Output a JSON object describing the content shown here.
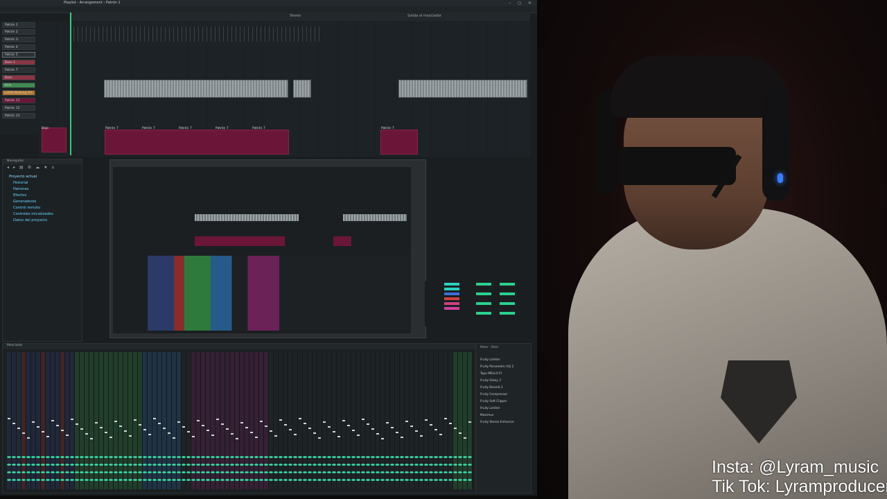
{
  "window": {
    "title": "Playlist - Arrangement › Patrón 1",
    "controls": "– ◻ ✕"
  },
  "playlist": {
    "markers": [
      "Stereo",
      "Salida al mezclador"
    ],
    "tracks": [
      "Patrón 1",
      "Patrón 2",
      "Patrón 3",
      "Patrón 4",
      "Patrón 5",
      "Bass 1",
      "Patrón 7",
      "Bass",
      "Kick",
      "LOAD Nothing #1",
      "Patrón 11",
      "Patrón 12",
      "Patrón 13"
    ],
    "clip_labels": [
      "Bajo",
      "Patrón 7",
      "Patrón 7",
      "Patrón 7",
      "Patrón 7",
      "Patrón 7",
      "Patrón 7"
    ]
  },
  "browser": {
    "title": "Navegador",
    "items": [
      {
        "label": "Proyecto actual",
        "level": 0
      },
      {
        "label": "Historial",
        "level": 1
      },
      {
        "label": "Patrones",
        "level": 1
      },
      {
        "label": "Efectos",
        "level": 1
      },
      {
        "label": "Generadores",
        "level": 1
      },
      {
        "label": "Control remoto",
        "level": 1
      },
      {
        "label": "Controles inicializados",
        "level": 1
      },
      {
        "label": "Datos del proyecto",
        "level": 1
      }
    ]
  },
  "mixer": {
    "title": "Mezclador",
    "fx_title": "Mixer - Bass",
    "fx_slots": [
      "Fruity Limiter",
      "Fruity Parametric EQ 2",
      "Tape MELLO-FI",
      "Fruity Delay 3",
      "Fruity Reverb 2",
      "Fruity Compressor",
      "Fruity Soft Clipper",
      "Fruity Limiter",
      "Maximus",
      "Fruity Stereo Enhancer"
    ]
  },
  "overlay": {
    "insta": "Insta: @Lyram_music",
    "tiktok": "Tik Tok: Lyramproducer"
  },
  "colors": {
    "accent": "#2bd17b",
    "clip_pink": "#6b1638",
    "browser_link": "#66d6ff"
  }
}
